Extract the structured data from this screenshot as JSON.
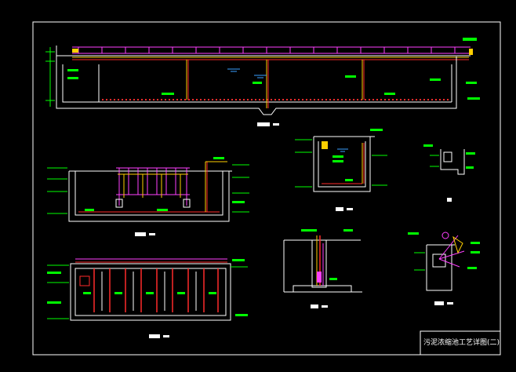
{
  "title_block": {
    "drawing_title": "污泥浓缩池工艺详图(二)"
  },
  "colors": {
    "background": "#000000",
    "frame": "#ffffff",
    "structure": "#ffffff",
    "pipe_red": "#ff2a2a",
    "pipe_yellow": "#ffd000",
    "dim_green": "#00ff00",
    "walkway_magenta": "#ff40ff",
    "water_blue": "#3aa0ff",
    "detail_cyan": "#00e0e0"
  },
  "views": [
    {
      "id": "view-1",
      "name": "longitudinal-section"
    },
    {
      "id": "view-2",
      "name": "cross-section"
    },
    {
      "id": "view-3",
      "name": "plan-view"
    },
    {
      "id": "view-4",
      "name": "section-1-1"
    },
    {
      "id": "view-5",
      "name": "section-2-2"
    },
    {
      "id": "view-6",
      "name": "detail-node-a"
    },
    {
      "id": "view-7",
      "name": "detail-node-b"
    }
  ]
}
